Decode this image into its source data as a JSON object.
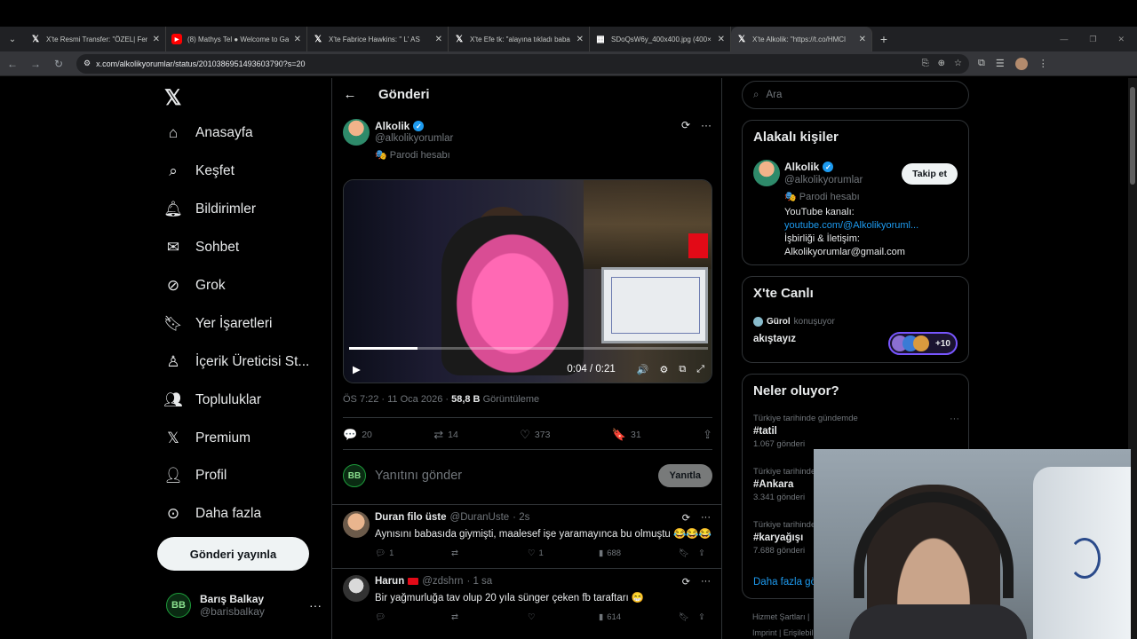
{
  "browser": {
    "tabs": [
      {
        "favicon": "x",
        "title": "X'te Resmi Transfer: \"ÖZEL| Fenerbahçe",
        "active": false
      },
      {
        "favicon": "yt",
        "title": "(8) Mathys Tel ● Welcome to Ga",
        "active": false
      },
      {
        "favicon": "x",
        "title": "X'te Fabrice Hawkins: \" L' AS",
        "active": false
      },
      {
        "favicon": "x",
        "title": "X'te Efe tk: \"alayına tıkladı baba",
        "active": false
      },
      {
        "favicon": "img",
        "title": "SDoQsW6y_400x400.jpg (400×",
        "active": false
      },
      {
        "favicon": "x",
        "title": "X'te Alkolik: \"https://t.co/HMCl",
        "active": true
      }
    ],
    "url": "x.com/alkolikyorumlar/status/2010386951493603790?s=20"
  },
  "nav": {
    "items": [
      {
        "icon": "home-icon",
        "label": "Anasayfa"
      },
      {
        "icon": "search-icon",
        "label": "Keşfet"
      },
      {
        "icon": "bell-icon",
        "label": "Bildirimler"
      },
      {
        "icon": "mail-icon",
        "label": "Sohbet"
      },
      {
        "icon": "grok-icon",
        "label": "Grok"
      },
      {
        "icon": "bookmark-icon",
        "label": "Yer İşaretleri"
      },
      {
        "icon": "creator-icon",
        "label": "İçerik Üreticisi St..."
      },
      {
        "icon": "communities-icon",
        "label": "Topluluklar"
      },
      {
        "icon": "x-premium-icon",
        "label": "Premium"
      },
      {
        "icon": "profile-icon",
        "label": "Profil"
      },
      {
        "icon": "more-icon",
        "label": "Daha fazla"
      }
    ],
    "post_button": "Gönderi yayınla",
    "me": {
      "initials": "BB",
      "name": "Barış Balkay",
      "handle": "@barisbalkay"
    }
  },
  "post": {
    "header_title": "Gönderi",
    "author_name": "Alkolik",
    "author_handle": "@alkolikyorumlar",
    "parody_label": "Parodi hesabı",
    "video_time": "0:04 / 0:21",
    "video_progress": 0.19,
    "timestamp": "ÖS 7:22 · 11 Oca 2026 ·",
    "views_count": "58,8 B",
    "views_label": "Görüntüleme",
    "stats": {
      "replies": "20",
      "reposts": "14",
      "likes": "373",
      "bookmarks": "31"
    },
    "reply_placeholder": "Yanıtını gönder",
    "reply_button": "Yanıtla",
    "reply_initials": "BB"
  },
  "replies": [
    {
      "name": "Duran filo üste",
      "handle": "@DuranUste",
      "time": "· 2s",
      "text": "Aynısını babasıda giymişti, maalesef işe yaramayınca bu olmuştu 😂😂😂",
      "replies": "1",
      "reposts": "",
      "likes": "1",
      "views": "688"
    },
    {
      "name": "Harun",
      "handle": "@zdshrn",
      "time": "· 1 sa",
      "text": "Bir yağmurluğa tav olup 20 yıla sünger çeken fb taraftarı 😁",
      "replies": "",
      "reposts": "",
      "likes": "",
      "views": "614"
    }
  ],
  "right": {
    "search_placeholder": "Ara",
    "related_title": "Alakalı kişiler",
    "related": {
      "name": "Alkolik",
      "handle": "@alkolikyorumlar",
      "parody": "Parodi hesabı",
      "follow": "Takip et",
      "bio_line1": "YouTube kanalı:",
      "bio_link": "youtube.com/@Alkolikyoruml...",
      "bio_line2": "İşbirliği & İletişim:",
      "bio_line3": "Alkolikyorumlar@gmail.com"
    },
    "live_title": "X'te Canlı",
    "live": {
      "host": "Gürol",
      "host_status": "konuşuyor",
      "space_title": "akıştayız",
      "listeners": "+10"
    },
    "trends_title": "Neler oluyor?",
    "trends": [
      {
        "context": "Türkiye tarihinde gündemde",
        "tag": "#tatil",
        "count": "1.067 gönderi"
      },
      {
        "context": "Türkiye tarihinde gündemde",
        "tag": "#Ankara",
        "count": "3.341 gönderi"
      },
      {
        "context": "Türkiye tarihinde gündemde",
        "tag": "#karyağışı",
        "count": "7.688 gönderi"
      }
    ],
    "show_more": "Daha fazla göster",
    "footer1": "Hizmet Şartları  |",
    "footer2": "Imprint  |  Erişilebilirlik"
  },
  "colors": {
    "accent": "#1d9bf0",
    "verified": "#1d9bf0",
    "live_ring": "#7856ff",
    "background": "#000000"
  }
}
